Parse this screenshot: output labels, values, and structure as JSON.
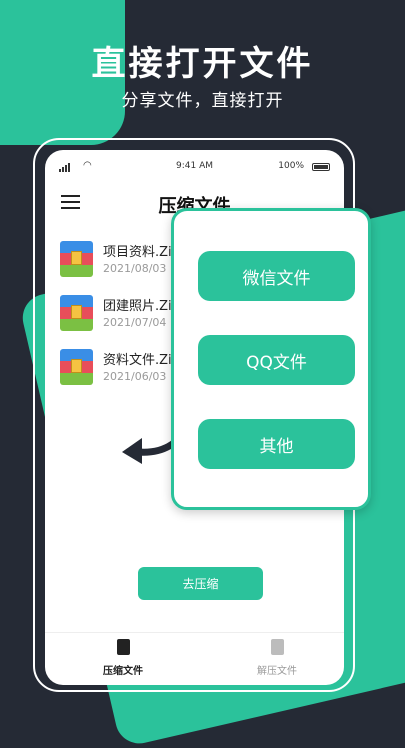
{
  "promo": {
    "headline": "直接打开文件",
    "subheadline": "分享文件，直接打开"
  },
  "status_bar": {
    "time": "9:41 AM",
    "battery": "100%"
  },
  "screen": {
    "title": "压缩文件"
  },
  "files": [
    {
      "name": "项目资料.Zi",
      "date": "2021/08/03"
    },
    {
      "name": "团建照片.Zi",
      "date": "2021/07/04"
    },
    {
      "name": "资料文件.Zi",
      "date": "2021/06/03"
    }
  ],
  "compress_button": "去压缩",
  "tabs": {
    "compress": "压缩文件",
    "decompress": "解压文件"
  },
  "popup": {
    "options": [
      "微信文件",
      "QQ文件",
      "其他"
    ]
  },
  "colors": {
    "accent": "#2bc29b",
    "dark_bg": "#252a35"
  },
  "icons": {
    "menu": "hamburger-icon",
    "file": "zip-archive-icon",
    "arrow": "curved-arrow-left-icon"
  }
}
